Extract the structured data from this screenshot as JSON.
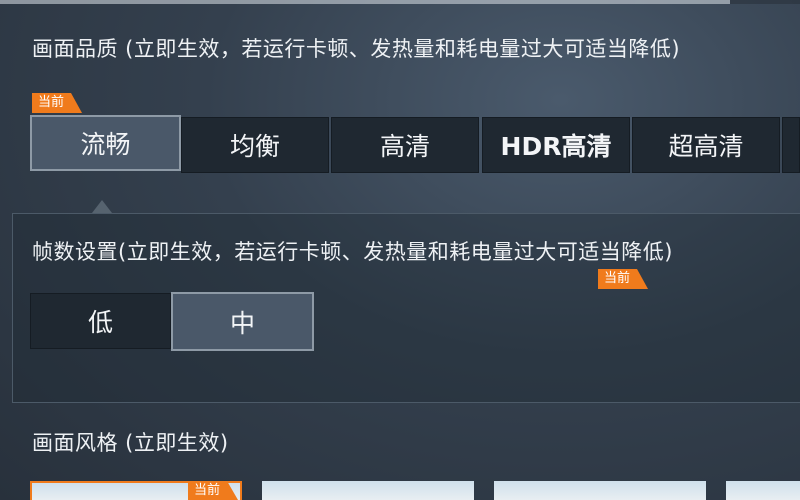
{
  "quality": {
    "heading": "画面品质 (立即生效，若运行卡顿、发热量和耗电量过大可适当降低)",
    "current_badge": "当前",
    "options": [
      "流畅",
      "均衡",
      "高清",
      "HDR高清",
      "超高清"
    ],
    "selected": "流畅"
  },
  "framerate": {
    "heading": "帧数设置(立即生效，若运行卡顿、发热量和耗电量过大可适当降低)",
    "current_badge": "当前",
    "options": [
      "低",
      "中"
    ],
    "selected": "中"
  },
  "style": {
    "heading": "画面风格 (立即生效)",
    "current_badge": "当前"
  },
  "colors": {
    "accent": "#f07b1c",
    "selected_bg": "#4a5869",
    "button_bg": "#1f2831"
  }
}
